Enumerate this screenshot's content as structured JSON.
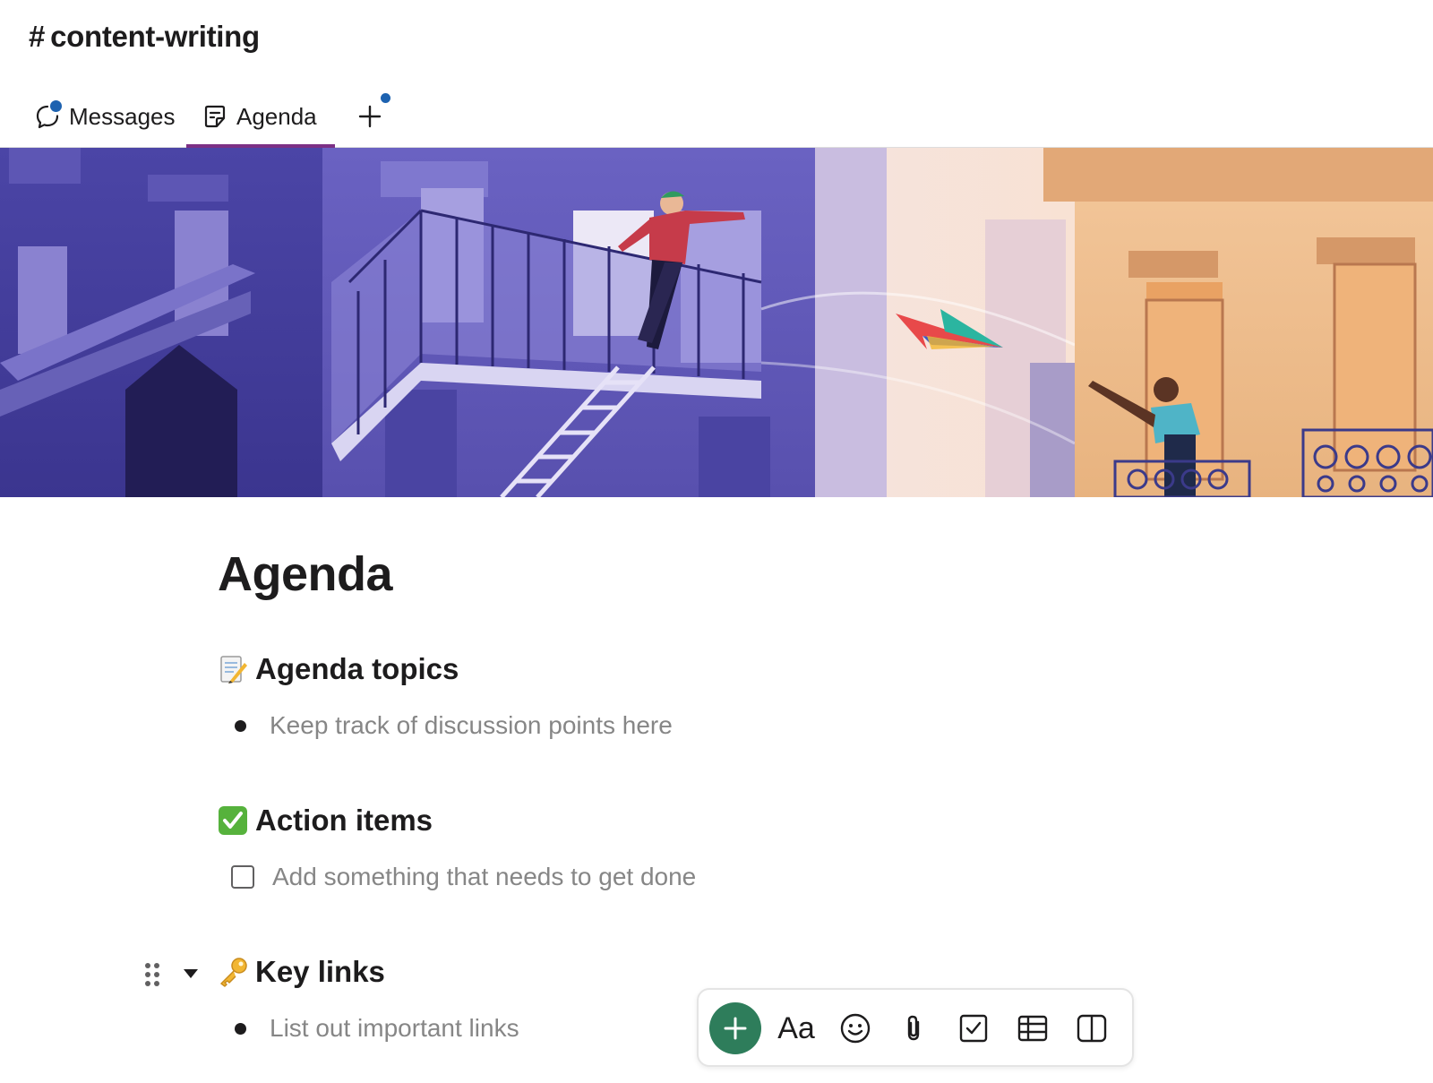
{
  "channel": {
    "hash": "#",
    "name": "content-writing"
  },
  "tabs": [
    {
      "label": "Messages",
      "icon": "message-bubble-icon"
    },
    {
      "label": "Agenda",
      "icon": "canvas-note-icon"
    },
    {
      "label": "",
      "icon": "plus-icon"
    }
  ],
  "banner": {
    "description_icon": "illustration-balconies-paper-plane"
  },
  "doc": {
    "title": "Agenda",
    "sections": [
      {
        "emoji": "memo-icon",
        "heading": "Agenda topics",
        "item_type": "bullet",
        "item": "Keep track of discussion points here"
      },
      {
        "emoji": "check-mark-button-icon",
        "heading": "Action items",
        "item_type": "checkbox",
        "item": "Add something that needs to get done"
      },
      {
        "emoji": "key-icon",
        "heading": "Key links",
        "item_type": "bullet",
        "item": "List out important links"
      }
    ]
  },
  "toolbar": {
    "text_format_label": "Aa",
    "buttons": [
      "plus-icon",
      "text-format",
      "emoji-icon",
      "attachment-icon",
      "checklist-icon",
      "table-icon",
      "columns-icon"
    ]
  },
  "colors": {
    "accent_tab": "#7c3085",
    "notification_dot": "#1d62b0",
    "plus_button": "#2e7d5b"
  }
}
